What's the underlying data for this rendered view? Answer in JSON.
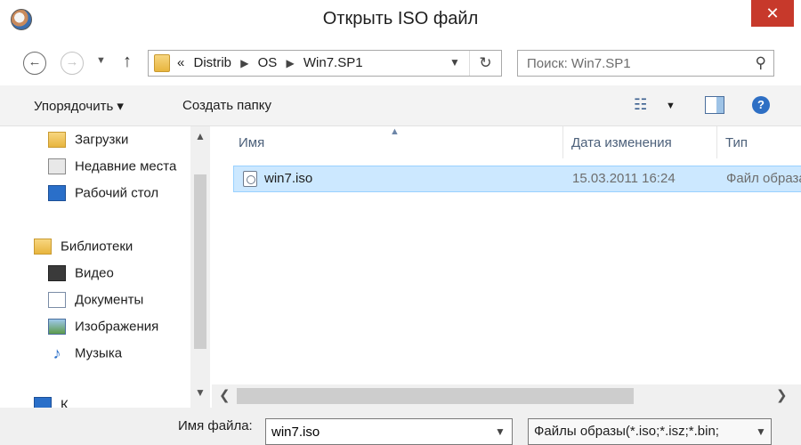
{
  "window": {
    "title": "Открыть ISO файл",
    "close_glyph": "✕"
  },
  "address": {
    "overflow": "«",
    "crumbs": [
      "Distrib",
      "OS",
      "Win7.SP1"
    ],
    "search_placeholder": "Поиск: Win7.SP1"
  },
  "toolbar": {
    "organize_label": "Упорядочить ▾",
    "new_folder_label": "Создать папку"
  },
  "sidebar": {
    "items": [
      {
        "label": "Загрузки",
        "icon": "downloads-icon"
      },
      {
        "label": "Недавние места",
        "icon": "recent-places-icon"
      },
      {
        "label": "Рабочий стол",
        "icon": "desktop-icon"
      },
      {
        "label": "Библиотеки",
        "icon": "libraries-icon"
      },
      {
        "label": "Видео",
        "icon": "video-icon"
      },
      {
        "label": "Документы",
        "icon": "documents-icon"
      },
      {
        "label": "Изображения",
        "icon": "pictures-icon"
      },
      {
        "label": "Музыка",
        "icon": "music-icon"
      },
      {
        "label": "К",
        "icon": "computer-icon"
      }
    ]
  },
  "filelist": {
    "columns": [
      "Имя",
      "Дата изменения",
      "Тип"
    ],
    "rows": [
      {
        "name": "win7.iso",
        "date": "15.03.2011 16:24",
        "type": "Файл образа"
      }
    ]
  },
  "bottom": {
    "filename_label": "Имя файла:",
    "filename_value": "win7.iso",
    "filetype_value": "Файлы образы(*.iso;*.isz;*.bin;"
  },
  "colors": {
    "selection_bg": "#cce8ff",
    "close_button": "#c7392b",
    "header_text": "#4c607a"
  }
}
